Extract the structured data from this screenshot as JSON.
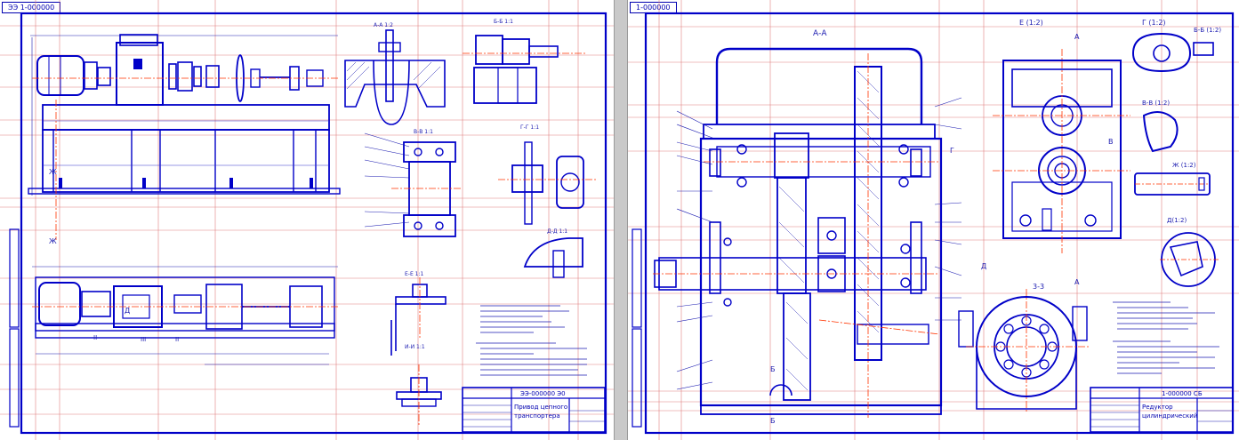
{
  "colors": {
    "outline": "#0000c8",
    "thin": "#1a1ab0",
    "axis": "#ff3300",
    "guide": "#e08080",
    "guide2": "#b04040",
    "dim": "#3333cc",
    "paper": "#ffffff"
  },
  "left": {
    "tab": "ЭЭ 1-000000",
    "view_main": {
      "label_letter": "Ж"
    },
    "view_top": {
      "labels": [
        "Д",
        "II",
        "III",
        "II"
      ]
    },
    "details": {
      "A": "А-А 1:2",
      "B": "Б-Б 1:1",
      "C": "В-В 1:1",
      "D": "Г-Г 1:1",
      "E": "Д-Д 1:1",
      "F": "Е-Е 1:1",
      "G": "И-И 1:1"
    },
    "title_block": {
      "code": "ЭЭ-000000 Э0",
      "name_line1": "Привод цепного",
      "name_line2": "транспортера"
    }
  },
  "right": {
    "tab": "1-000000",
    "section_AA": "А-А",
    "view_E": "Е (1:2)",
    "view_G": "Г (1:2)",
    "section_BB": "Б-Б (1:2)",
    "section_VV": "В-В (1:2)",
    "view_Zh": "Ж (1:2)",
    "view_D": "Д(1:2)",
    "section_33": "3-3",
    "letters": [
      "Г",
      "Д",
      "Б",
      "Б",
      "А",
      "А",
      "В"
    ],
    "title_block": {
      "code": "1-000000 СБ",
      "name_line1": "Редуктор",
      "name_line2": "цилиндрический"
    }
  }
}
